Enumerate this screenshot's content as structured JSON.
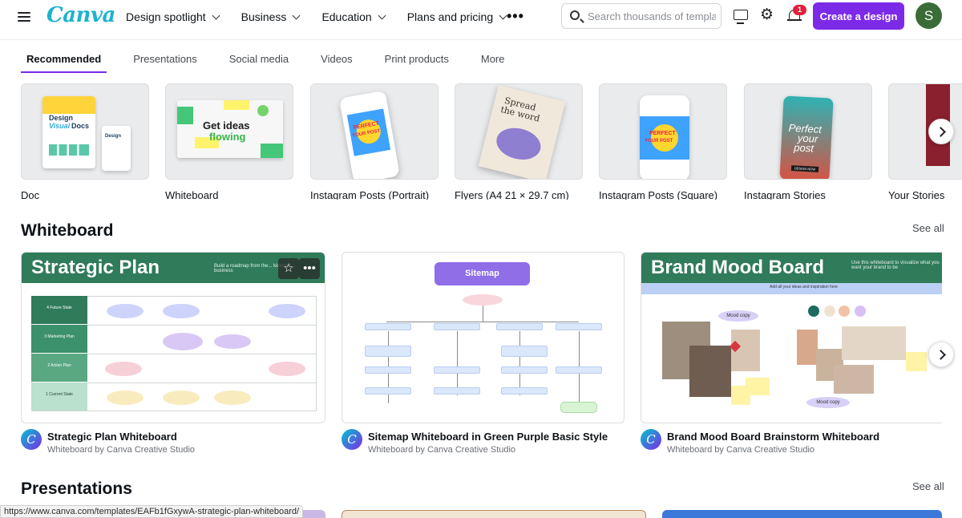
{
  "header": {
    "logo": "Canva",
    "nav": [
      "Design spotlight",
      "Business",
      "Education",
      "Plans and pricing"
    ],
    "more": "•••",
    "search_placeholder": "Search thousands of templates",
    "notification_count": "1",
    "create_button": "Create a design",
    "avatar_initial": "S"
  },
  "tabs": [
    "Recommended",
    "Presentations",
    "Social media",
    "Videos",
    "Print products",
    "More"
  ],
  "design_types": [
    {
      "label": "Doc",
      "thumb_text": [
        "Design",
        "Visual",
        "Docs"
      ]
    },
    {
      "label": "Whiteboard",
      "thumb_text": [
        "Get ideas",
        "flowing"
      ]
    },
    {
      "label": "Instagram Posts (Portrait)",
      "thumb_text": [
        "PERFECT",
        "YOUR POST"
      ]
    },
    {
      "label": "Flyers (A4 21 × 29.7 cm)",
      "thumb_text": [
        "Spread",
        "the word"
      ]
    },
    {
      "label": "Instagram Posts (Square)",
      "thumb_text": [
        "PERFECT",
        "YOUR POST"
      ]
    },
    {
      "label": "Instagram Stories",
      "thumb_text": [
        "Perfect",
        "your",
        "post",
        "DESIGN NOW"
      ]
    },
    {
      "label": "Your Stories"
    }
  ],
  "sections": {
    "whiteboard": {
      "title": "Whiteboard",
      "see_all": "See all",
      "cards": [
        {
          "title": "Strategic Plan Whiteboard",
          "subtitle": "Whiteboard by Canva Creative Studio",
          "thumb_title": "Strategic Plan",
          "thumb_caption": "Build a roadmap from the... kickstart... business",
          "rows": [
            "4 Future State",
            "3 Marketing Plan",
            "2 Action Plan",
            "1 Current State"
          ]
        },
        {
          "title": "Sitemap Whiteboard in Green Purple Basic Style",
          "subtitle": "Whiteboard by Canva Creative Studio",
          "thumb_title": "Sitemap"
        },
        {
          "title": "Brand Mood Board Brainstorm Whiteboard",
          "subtitle": "Whiteboard by Canva Creative Studio",
          "thumb_title": "Brand Mood Board",
          "thumb_caption": "Use this whiteboard to visualize what you want your brand to be",
          "strip_text": "Add all your ideas and inspiration here",
          "labels": [
            "Mood copy",
            "Mood copy"
          ]
        }
      ]
    },
    "presentations": {
      "title": "Presentations",
      "see_all": "See all"
    }
  },
  "status_url": "https://www.canva.com/templates/EAFb1fGxywA-strategic-plan-whiteboard/",
  "colors": {
    "brand_purple": "#7d2ae8",
    "canva_teal": "#1cb3cf",
    "board_green": "#2f7b5a",
    "avatar_green": "#3a6c37",
    "badge_red": "#e0203c"
  }
}
